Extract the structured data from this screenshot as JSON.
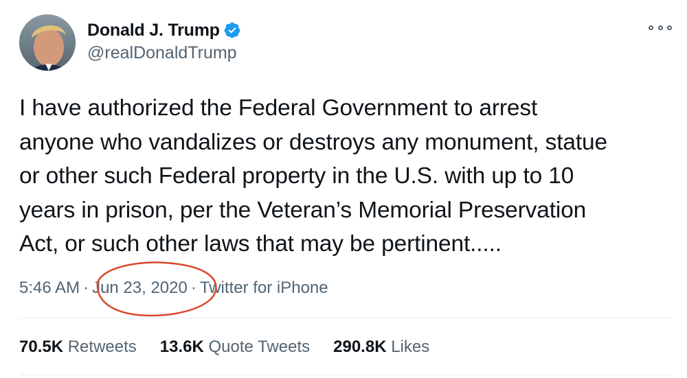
{
  "author": {
    "display_name": "Donald J. Trump",
    "handle": "@realDonaldTrump",
    "verified": true,
    "avatar_icon": "profile-photo"
  },
  "tweet": {
    "text": "I have authorized the Federal Government to arrest\nanyone who vandalizes or destroys any monument, statue\nor other such Federal property in the U.S. with up to 10\nyears in prison, per the Veteran’s Memorial Preservation\nAct, or such other laws that may be pertinent.....",
    "time": "5:46 AM",
    "separator": "·",
    "date": "Jun 23, 2020",
    "source": "Twitter for iPhone"
  },
  "stats": {
    "retweets_count": "70.5K",
    "retweets_label": "Retweets",
    "quotes_count": "13.6K",
    "quotes_label": "Quote Tweets",
    "likes_count": "290.8K",
    "likes_label": "Likes"
  },
  "colors": {
    "verified_blue": "#1d9bf0",
    "secondary_text": "#536471",
    "annotation_red": "#d9472b"
  }
}
